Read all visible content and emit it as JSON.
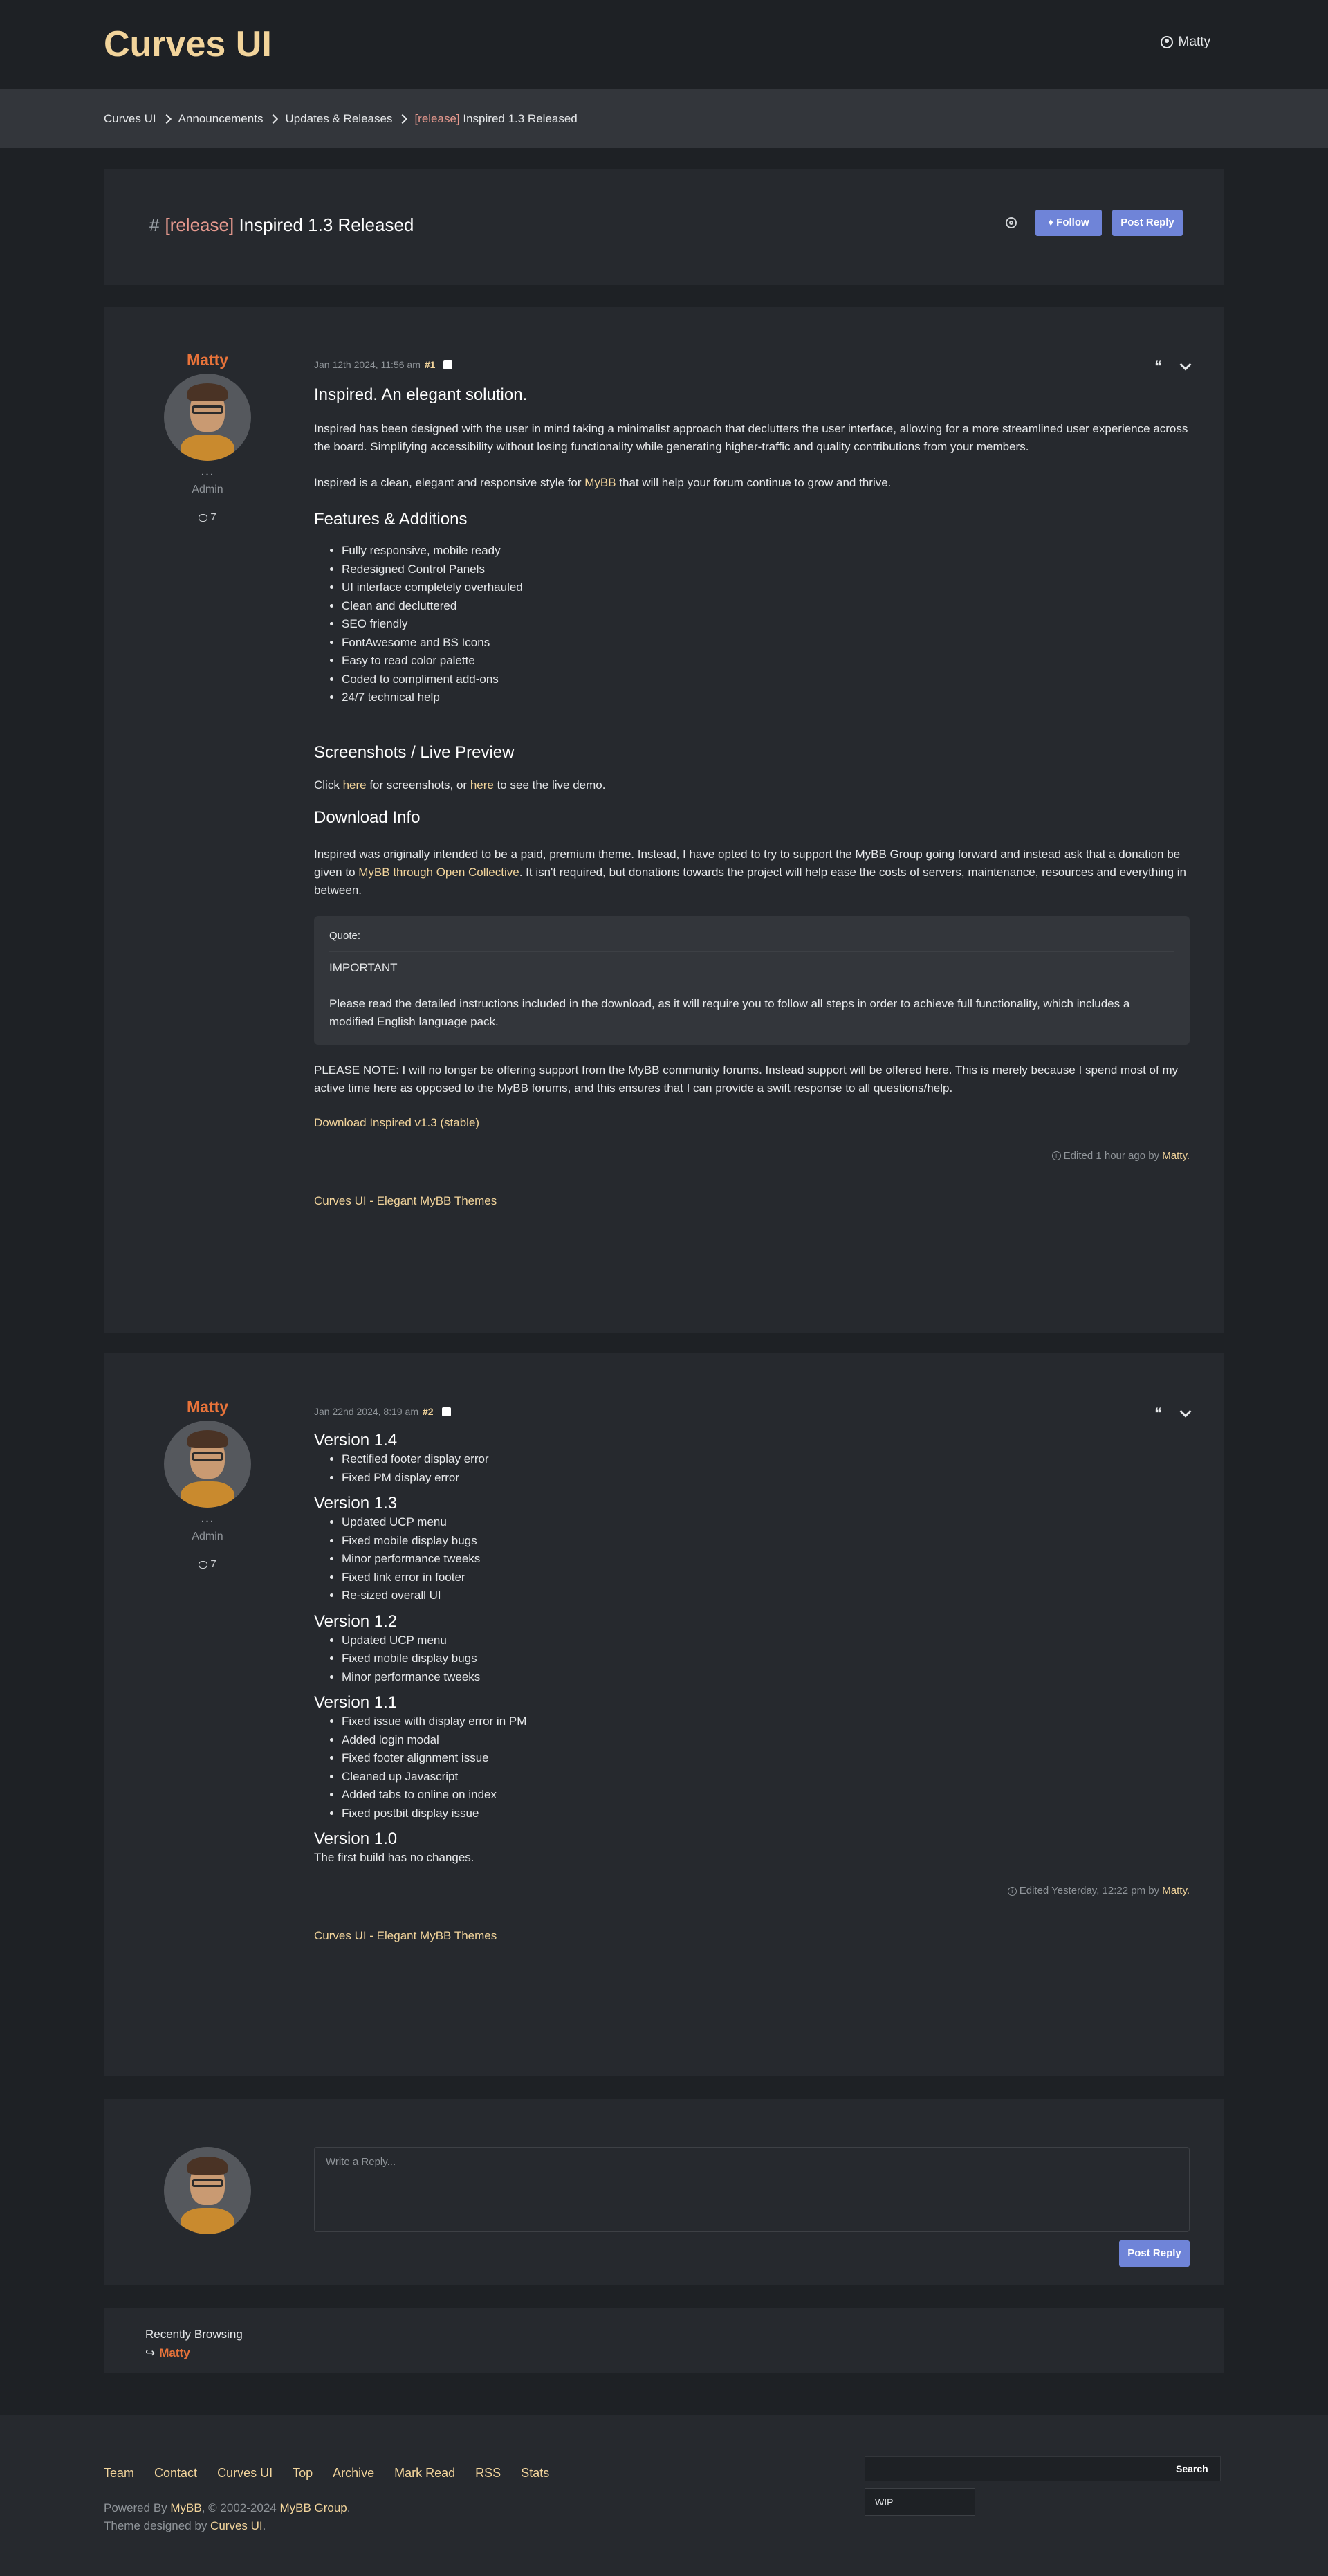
{
  "header": {
    "logo": "Curves UI",
    "username": "Matty"
  },
  "breadcrumb": {
    "items": [
      "Curves UI",
      "Announcements",
      "Updates & Releases"
    ],
    "current_prefix": "[release]",
    "current_title": "Inspired 1.3 Released"
  },
  "thread": {
    "hash": "#",
    "prefix": "[release]",
    "title": "Inspired 1.3 Released",
    "follow_label": "Follow",
    "reply_label": "Post Reply"
  },
  "post1": {
    "author": "Matty",
    "dots": "...",
    "role": "Admin",
    "post_count": "7",
    "date": "Jan 12th 2024, 11:56 am",
    "number": "#1",
    "heading": "Inspired. An elegant solution.",
    "p1": "Inspired has been designed with the user in mind taking a minimalist approach that declutters the user interface, allowing for a more streamlined user experience across the board. Simplifying accessibility without losing functionality while generating higher-traffic and quality contributions from your members.",
    "p2_before": "Inspired is a clean, elegant and responsive style for ",
    "p2_link": "MyBB",
    "p2_after": " that will help your forum continue to grow and thrive.",
    "features_heading": "Features & Additions",
    "features": [
      "Fully responsive, mobile ready",
      "Redesigned Control Panels",
      "UI interface completely overhauled",
      "Clean and decluttered",
      "SEO friendly",
      "FontAwesome and BS Icons",
      "Easy to read color palette",
      "Coded to compliment add-ons",
      "24/7 technical help"
    ],
    "screens_heading": "Screenshots / Live Preview",
    "screens_a": "Click ",
    "screens_link1": "here",
    "screens_b": " for screenshots, or ",
    "screens_link2": "here",
    "screens_c": " to see the live demo.",
    "download_heading": "Download Info",
    "download_a": "Inspired was originally intended to be a paid, premium theme. Instead, I have opted to try to support the MyBB Group going forward and instead ask that a donation be given to ",
    "download_link": "MyBB through Open Collective",
    "download_b": ". It isn't required, but donations towards the project will help ease the costs of servers, maintenance, resources and everything in between.",
    "quote_label": "Quote:",
    "quote_title": "IMPORTANT",
    "quote_text": "Please read the detailed instructions included in the download, as it will require you to follow all steps in order to achieve full functionality, which includes a modified English language pack.",
    "note": "PLEASE NOTE: I will no longer be offering support from the MyBB community forums. Instead support will be offered here. This is merely because I spend most of my active time here as opposed to the MyBB forums, and this ensures that I can provide a swift response to all questions/help.",
    "download_link_label": "Download Inspired v1.3 (stable)",
    "edited_text": "Edited 1 hour ago by",
    "edited_by": "Matty.",
    "signature": "Curves UI - Elegant MyBB Themes"
  },
  "post2": {
    "author": "Matty",
    "dots": "...",
    "role": "Admin",
    "post_count": "7",
    "date": "Jan 22nd 2024, 8:19 am",
    "number": "#2",
    "versions": [
      {
        "title": "Version 1.4",
        "items": [
          "Rectified footer display error",
          "Fixed PM display error"
        ]
      },
      {
        "title": "Version 1.3",
        "items": [
          "Updated UCP menu",
          "Fixed mobile display bugs",
          "Minor performance tweeks",
          "Fixed link error in footer",
          "Re-sized overall UI"
        ]
      },
      {
        "title": "Version 1.2",
        "items": [
          "Updated UCP menu",
          "Fixed mobile display bugs",
          "Minor performance tweeks"
        ]
      },
      {
        "title": "Version 1.1",
        "items": [
          "Fixed issue with display error in PM",
          "Added login modal",
          "Fixed footer alignment issue",
          "Cleaned up Javascript",
          "Added tabs to online on index",
          "Fixed postbit display issue"
        ]
      }
    ],
    "v10_title": "Version 1.0",
    "v10_text": "The first build has no changes.",
    "edited_text": "Edited Yesterday, 12:22 pm by",
    "edited_by": "Matty.",
    "signature": "Curves UI - Elegant MyBB Themes"
  },
  "reply": {
    "placeholder": "Write a Reply...",
    "button": "Post Reply"
  },
  "browsing": {
    "title": "Recently Browsing",
    "arrow": "↪",
    "user": "Matty"
  },
  "footer": {
    "links": [
      "Team",
      "Contact",
      "Curves UI",
      "Top",
      "Archive",
      "Mark Read",
      "RSS",
      "Stats"
    ],
    "powered_a": "Powered By ",
    "powered_link": "MyBB",
    "powered_b": ", © 2002-2024 ",
    "powered_link2": "MyBB Group",
    "powered_c": ".",
    "theme_a": "Theme designed by ",
    "theme_link": "Curves UI",
    "theme_b": ".",
    "search_button": "Search",
    "select_value": "WIP"
  },
  "colors": {
    "accent": "#f2d49b",
    "author": "#e8733a",
    "button": "#6f84d8",
    "background": "#1e2125",
    "panel": "#26292e"
  }
}
